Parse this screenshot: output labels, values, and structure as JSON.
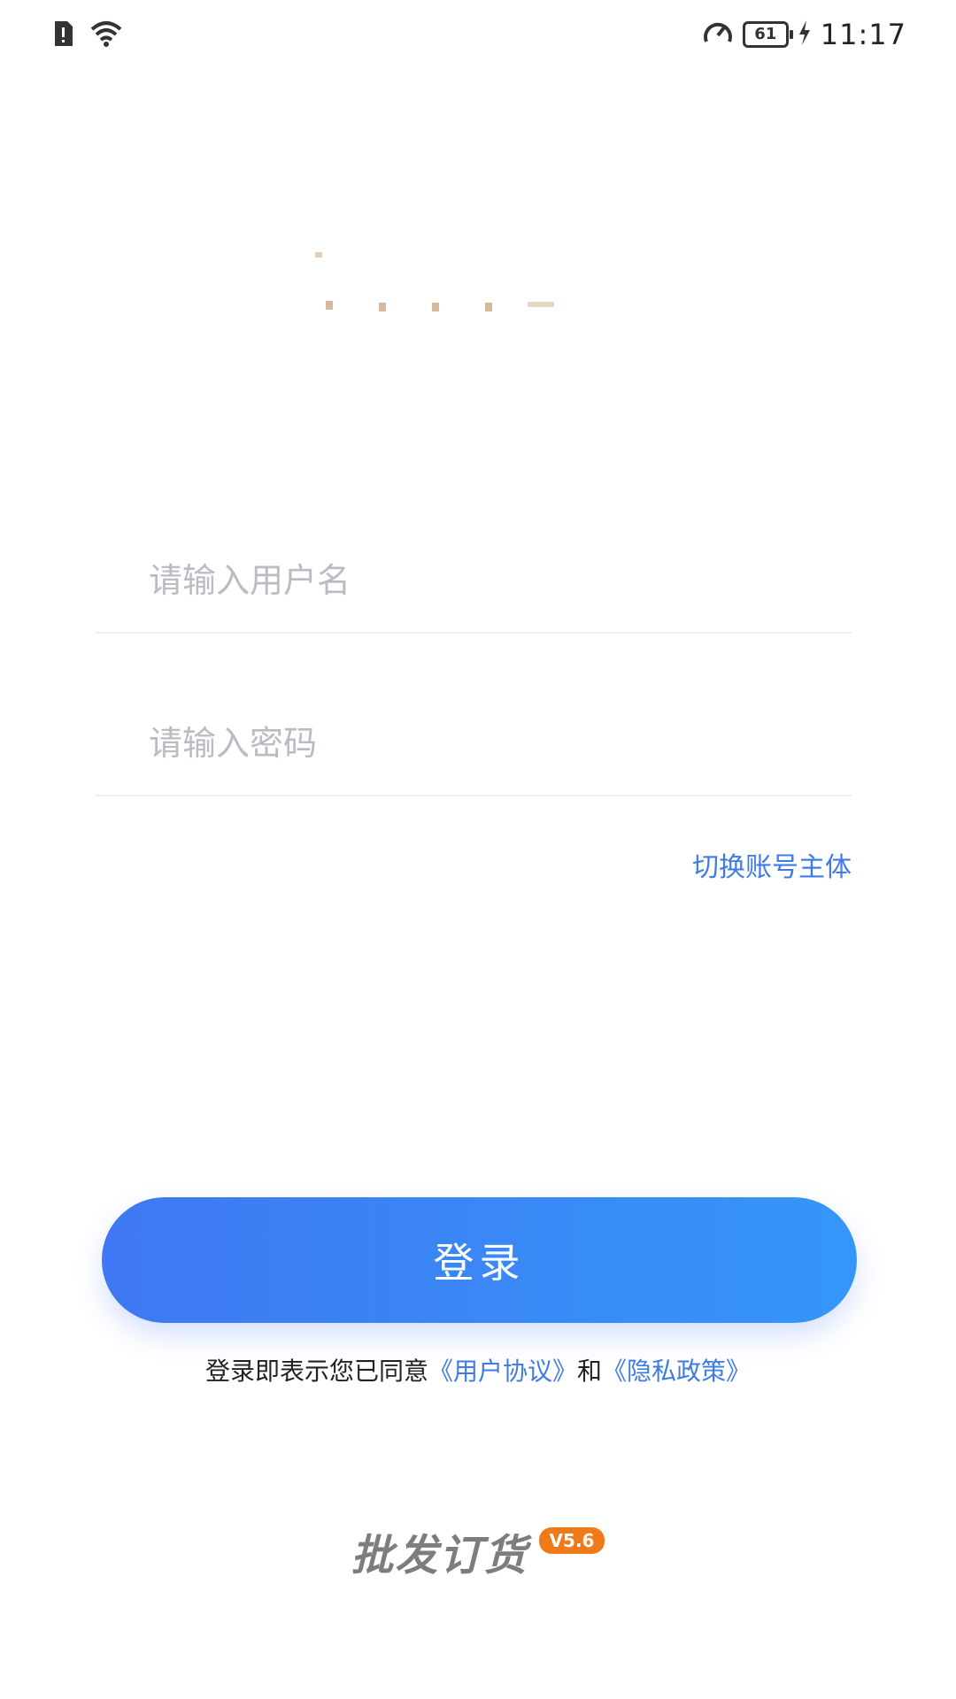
{
  "status_bar": {
    "time": "11:17",
    "battery": "61",
    "icons": [
      "sim-alert-icon",
      "wifi-icon",
      "speed-meter-icon",
      "battery-icon",
      "charging-icon"
    ]
  },
  "login": {
    "username_placeholder": "请输入用户名",
    "password_placeholder": "请输入密码",
    "switch_account": "切换账号主体",
    "login_button": "登录",
    "agreement_prefix": "登录即表示您已同意",
    "user_agreement": "《用户协议》",
    "conjunction": "和",
    "privacy_policy": "《隐私政策》"
  },
  "brand": {
    "app_name": "批发订货",
    "version": "V5.6"
  },
  "colors": {
    "accent": "#3f7be6",
    "button_start": "#3f78f2",
    "button_end": "#3596f8",
    "version_badge": "#f07a18"
  }
}
